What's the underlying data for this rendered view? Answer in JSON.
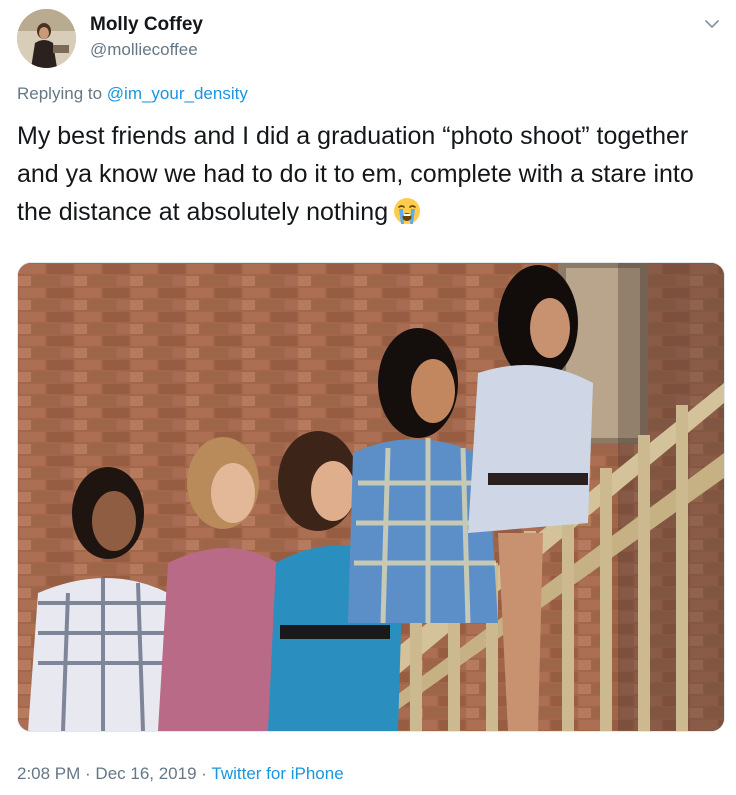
{
  "author": {
    "name": "Molly Coffey",
    "handle": "@molliecoffee"
  },
  "reply": {
    "prefix": "Replying to ",
    "mention": "@im_your_density"
  },
  "tweet_text": "My best friends and I did a graduation “photo shoot” together and ya know we had to do it to em, complete with a stare into the distance at absolutely nothing",
  "emoji": "loudly-crying-face",
  "meta": {
    "time": "2:08 PM",
    "sep1": " · ",
    "date": "Dec 16, 2019",
    "sep2": " · ",
    "source": "Twitter for iPhone"
  },
  "colors": {
    "link": "#1b95e0",
    "muted": "#657786",
    "text": "#14171a"
  },
  "icons": {
    "menu": "chevron-down-icon"
  }
}
